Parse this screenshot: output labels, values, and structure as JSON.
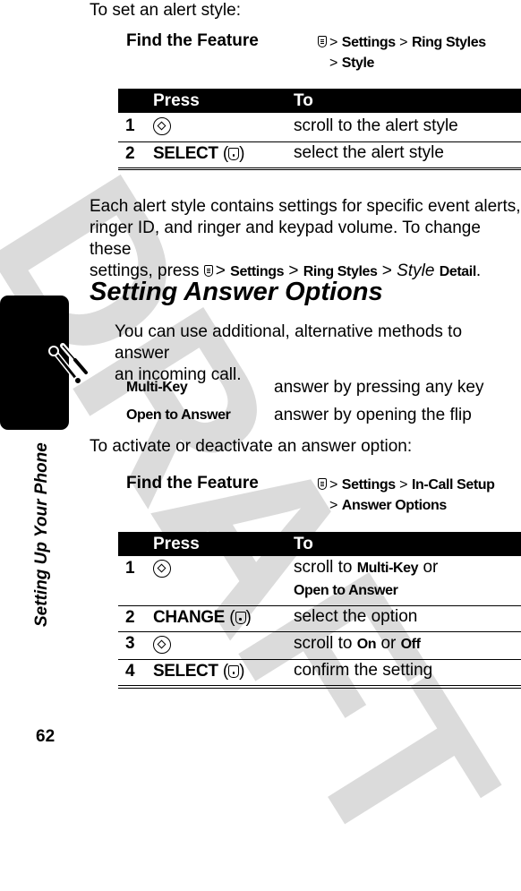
{
  "page": {
    "watermark": "DRAFT",
    "side_label": "Setting Up Your Phone",
    "page_number": "62",
    "side_icon": "wrench-screwdriver-icon"
  },
  "section1": {
    "intro": "To set an alert style:",
    "find_feature_label": "Find the Feature",
    "path": [
      "Settings",
      "Ring Styles",
      "Style"
    ],
    "table": {
      "headers": [
        "Press",
        "To"
      ],
      "rows": [
        {
          "num": "1",
          "press_icon": "nav-key-icon",
          "press_label": "",
          "to": "scroll to the alert style"
        },
        {
          "num": "2",
          "press_icon": "soft-key-icon",
          "press_label": "SELECT",
          "to": "select the alert style"
        }
      ]
    },
    "paragraph": {
      "line1": "Each alert style contains settings for specific event alerts,",
      "line2": "ringer ID, and ringer and keypad volume. To change these",
      "line3_prefix": "settings, press",
      "path": [
        "Settings",
        "Ring Styles"
      ],
      "style_italic": "Style",
      "detail": "Detail",
      "end": "."
    }
  },
  "section2": {
    "heading": "Setting Answer Options",
    "intro_line1": "You can use additional, alternative methods to answer",
    "intro_line2": "an incoming call.",
    "options": [
      {
        "name": "Multi-Key",
        "desc": "answer by pressing any key"
      },
      {
        "name": "Open to Answer",
        "desc": "answer by opening the flip"
      }
    ],
    "activate_text": "To activate or deactivate an answer option:",
    "find_feature_label": "Find the Feature",
    "path": [
      "Settings",
      "In-Call Setup",
      "Answer Options"
    ],
    "table": {
      "headers": [
        "Press",
        "To"
      ],
      "rows": [
        {
          "num": "1",
          "press_icon": "nav-key-icon",
          "press_label": "",
          "to_prefix": "scroll to",
          "to_b1": "Multi-Key",
          "to_mid": "or",
          "to_b2": "Open to Answer"
        },
        {
          "num": "2",
          "press_icon": "soft-key-icon",
          "press_label": "CHANGE",
          "to": "select the option"
        },
        {
          "num": "3",
          "press_icon": "nav-key-icon",
          "press_label": "",
          "to_prefix": "scroll to",
          "to_b1": "On",
          "to_mid": "or",
          "to_b2": "Off"
        },
        {
          "num": "4",
          "press_icon": "soft-key-icon",
          "press_label": "SELECT",
          "to": "confirm the setting"
        }
      ]
    }
  },
  "symbols": {
    "gt": ">",
    "paren_open": "(",
    "paren_close": ")"
  }
}
